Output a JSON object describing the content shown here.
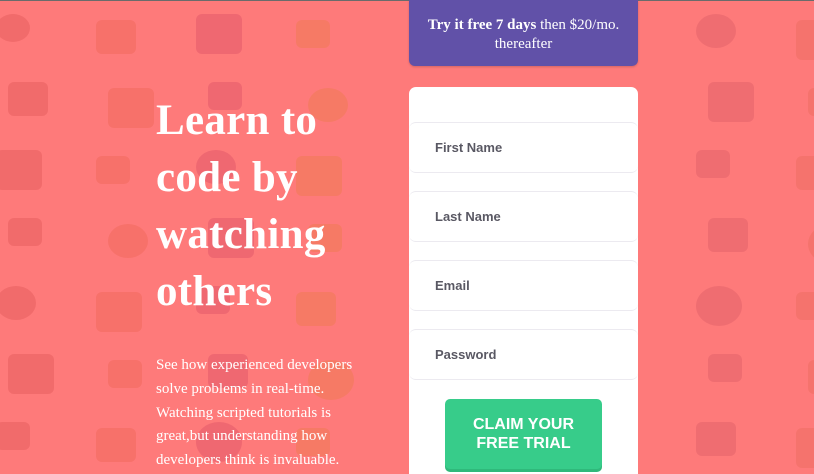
{
  "hero": {
    "title": "Learn to code by watching others",
    "description": "See how experienced developers solve problems in real-time. Watching scripted tutorials is great,but understanding how developers think is invaluable."
  },
  "trial": {
    "bold": "Try it free 7 days",
    "rest": " then $20/mo. thereafter"
  },
  "form": {
    "first_name_placeholder": "First Name",
    "last_name_placeholder": "Last Name",
    "email_placeholder": "Email",
    "password_placeholder": "Password",
    "submit_line1": "CLAIM YOUR",
    "submit_line2": "FREE TRIAL"
  },
  "colors": {
    "background": "#fe7a7a",
    "trial_box": "#6151a8",
    "submit": "#37cc8a",
    "card": "#ffffff"
  },
  "background_pattern_icons": [
    "monitor-icon",
    "headset-icon",
    "network-icon",
    "box-icon",
    "usb-icon",
    "chart-icon",
    "tablet-icon",
    "rocket-icon",
    "gear-icon",
    "lifebuoy-icon",
    "cart-icon",
    "calendar-icon"
  ]
}
